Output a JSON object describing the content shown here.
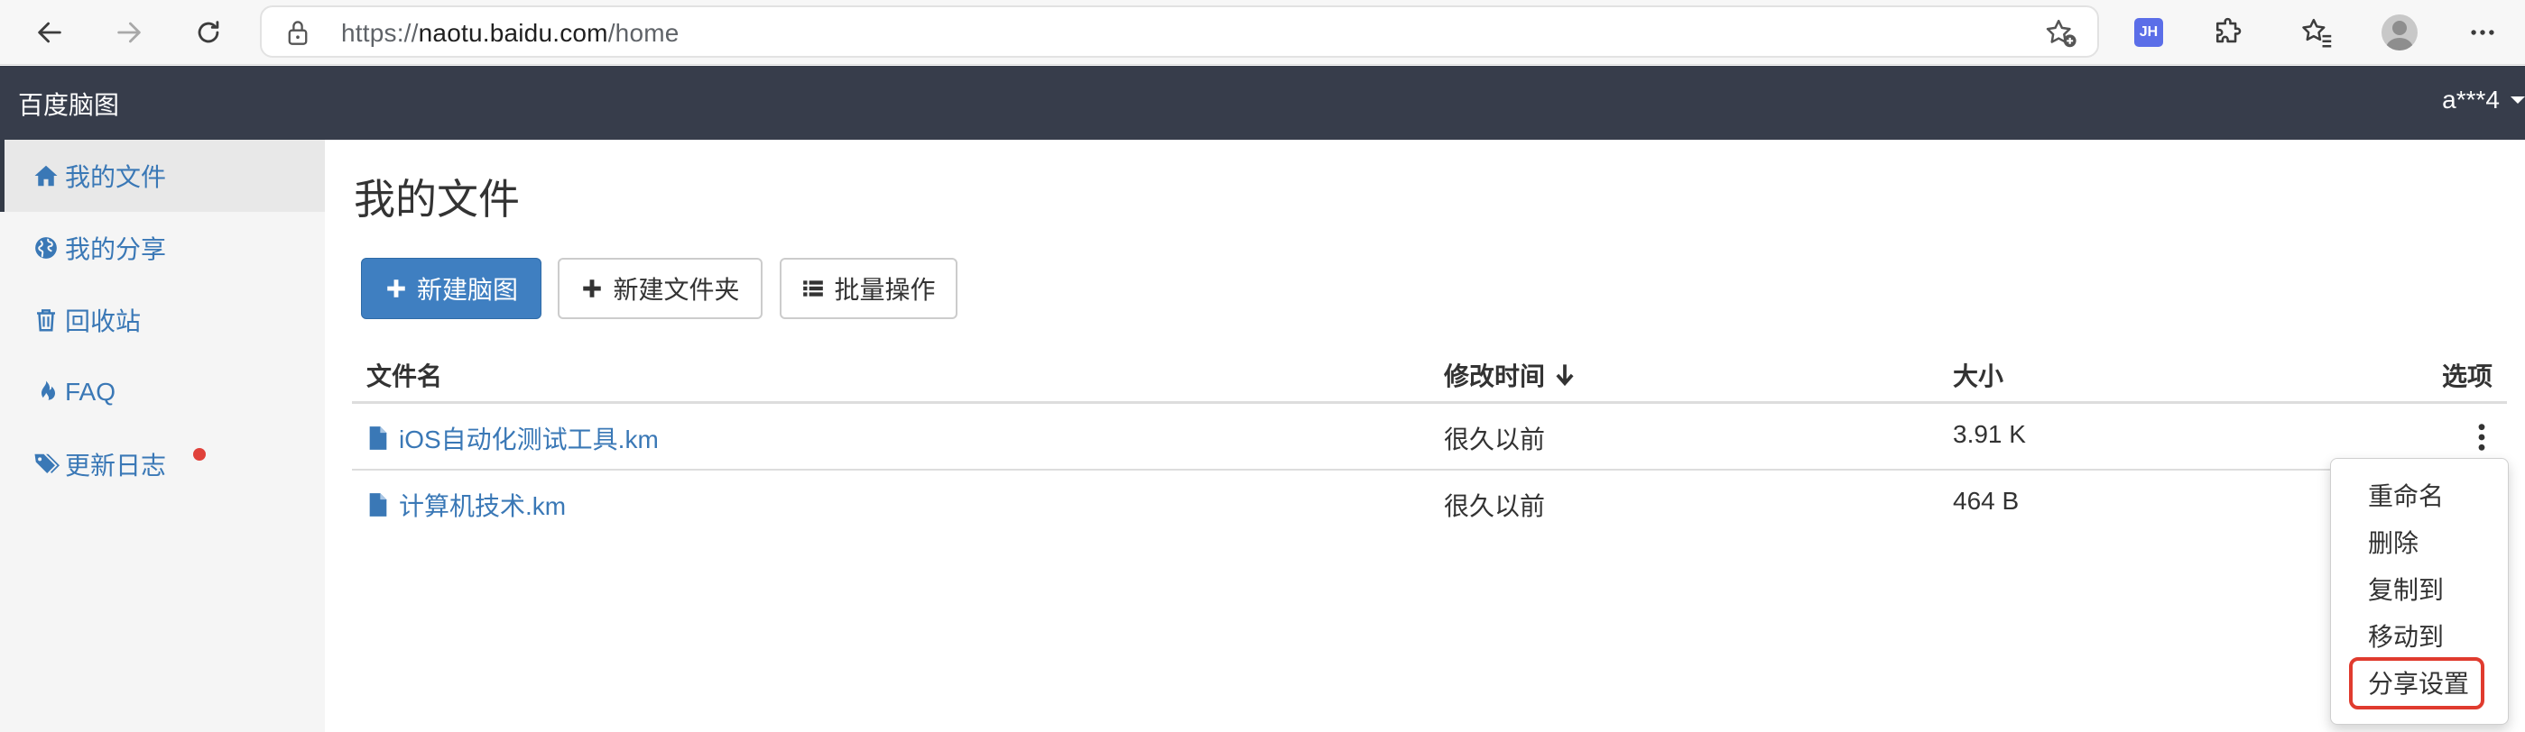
{
  "browser": {
    "url_prefix": "https://",
    "url_host": "naotu.baidu.com",
    "url_path": "/home",
    "extension_badge": "JH"
  },
  "app": {
    "title": "百度脑图",
    "user": "a***4"
  },
  "sidebar": {
    "items": [
      {
        "label": "我的文件",
        "icon": "home-icon"
      },
      {
        "label": "我的分享",
        "icon": "globe-icon"
      },
      {
        "label": "回收站",
        "icon": "trash-icon"
      },
      {
        "label": "FAQ",
        "icon": "fire-icon"
      },
      {
        "label": "更新日志",
        "icon": "tags-icon"
      }
    ]
  },
  "main": {
    "title": "我的文件",
    "toolbar": {
      "new_mindmap": "新建脑图",
      "new_folder": "新建文件夹",
      "batch": "批量操作"
    },
    "table": {
      "columns": [
        "文件名",
        "修改时间",
        "大小",
        "选项"
      ],
      "rows": [
        {
          "name": "iOS自动化测试工具.km",
          "modified": "很久以前",
          "size": "3.91 K"
        },
        {
          "name": "计算机技术.km",
          "modified": "很久以前",
          "size": "464 B"
        }
      ]
    },
    "options_menu": [
      "重命名",
      "删除",
      "复制到",
      "移动到",
      "分享设置"
    ]
  },
  "colors": {
    "header_bg": "#373d4b",
    "link": "#3a78b6",
    "primary_button": "#3f7fc1",
    "highlight_border": "#e03b2e",
    "badge_dot": "#e0413a"
  }
}
